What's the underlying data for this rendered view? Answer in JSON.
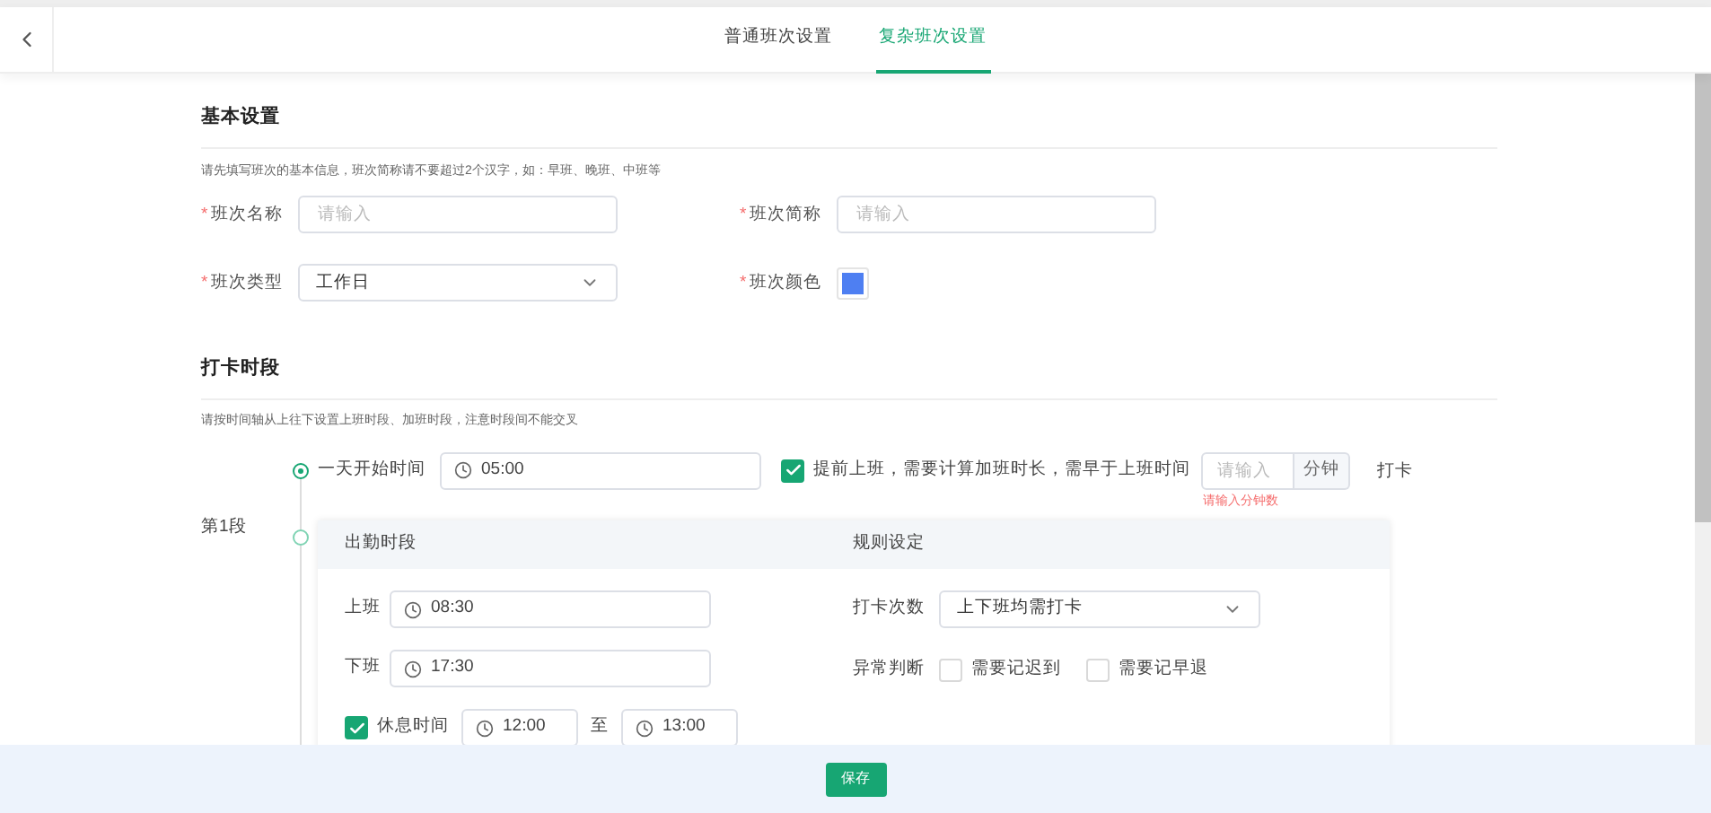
{
  "header": {
    "tabs": [
      {
        "label": "普通班次设置",
        "selected": false
      },
      {
        "label": "复杂班次设置",
        "selected": true
      }
    ]
  },
  "basic": {
    "title": "基本设置",
    "hint": "请先填写班次的基本信息，班次简称请不要超过2个汉字，如：早班、晚班、中班等",
    "fields": [
      {
        "kind": "input",
        "required_mark": "*",
        "label": "班次名称",
        "placeholder": "请输入"
      },
      {
        "kind": "input",
        "required_mark": "*",
        "label": "班次简称",
        "placeholder": "请输入"
      },
      {
        "kind": "select",
        "required_mark": "*",
        "label": "班次类型",
        "value": "工作日"
      },
      {
        "kind": "color",
        "required_mark": "*",
        "label": "班次颜色",
        "color": "#4e7ff2"
      }
    ]
  },
  "punch": {
    "title": "打卡时段",
    "hint": "请按时间轴从上往下设置上班时段、加班时段，注意时段间不能交叉",
    "start": {
      "label": "一天开始时间",
      "value": "05:00"
    },
    "early": {
      "checked": true,
      "label": "提前上班，需要计算加班时长，需早于上班时间",
      "placeholder": "请输入",
      "unit": "分钟",
      "suffix": "打卡",
      "error": "请输入分钟数"
    },
    "segment": {
      "label": "第1段",
      "left_title": "出勤时段",
      "right_title": "规则设定",
      "on_duty": {
        "label": "上班",
        "value": "08:30"
      },
      "off_duty": {
        "label": "下班",
        "value": "17:30"
      },
      "rest": {
        "checked": true,
        "label": "休息时间",
        "from": "12:00",
        "separator": "至",
        "to": "13:00"
      },
      "punch_count": {
        "label": "打卡次数",
        "value": "上下班均需打卡"
      },
      "exceptions": {
        "label": "异常判断",
        "options": [
          {
            "label": "需要记迟到",
            "checked": false
          },
          {
            "label": "需要记早退",
            "checked": false
          }
        ]
      }
    }
  },
  "footer": {
    "save": "保存"
  }
}
